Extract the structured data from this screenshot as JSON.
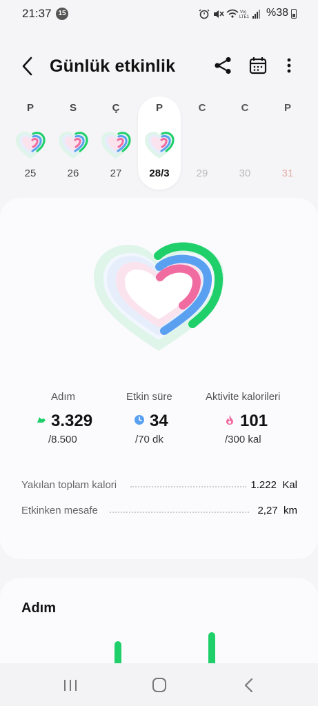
{
  "status": {
    "time": "21:37",
    "notif_count": "15",
    "battery": "%38"
  },
  "header": {
    "title": "Günlük etkinlik"
  },
  "week": [
    {
      "letter": "P",
      "date": "25"
    },
    {
      "letter": "S",
      "date": "26"
    },
    {
      "letter": "Ç",
      "date": "27"
    },
    {
      "letter": "P",
      "date": "28/3"
    },
    {
      "letter": "C",
      "date": "29"
    },
    {
      "letter": "C",
      "date": "30"
    },
    {
      "letter": "P",
      "date": "31"
    }
  ],
  "summary": {
    "steps": {
      "label": "Adım",
      "value": "3.329",
      "goal": "/8.500"
    },
    "active_time": {
      "label": "Etkin süre",
      "value": "34",
      "goal": "/70 dk"
    },
    "calories": {
      "label": "Aktivite kalorileri",
      "value": "101",
      "goal": "/300 kal"
    }
  },
  "details": [
    {
      "label": "Yakılan toplam kalori",
      "value": "1.222",
      "unit": "Kal"
    },
    {
      "label": "Etkinken mesafe",
      "value": "2,27",
      "unit": "km"
    }
  ],
  "steps_card": {
    "title": "Adım"
  },
  "colors": {
    "green": "#1fcf6a",
    "blue": "#5aa0f0",
    "pink": "#f06ca0",
    "sunday": "#e06060"
  }
}
